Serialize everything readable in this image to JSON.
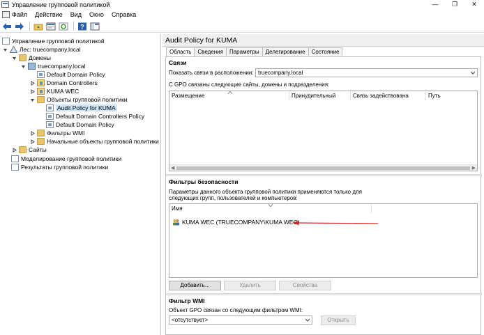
{
  "window": {
    "title": "Управление групповой политикой",
    "controls": [
      "—",
      "❐",
      "✕"
    ]
  },
  "menu": {
    "items": [
      "Файл",
      "Действие",
      "Вид",
      "Окно",
      "Справка"
    ]
  },
  "toolbar": {
    "icons": [
      "back-arrow-icon",
      "forward-arrow-icon",
      "folder-up-icon",
      "properties-icon",
      "refresh-icon",
      "help-icon",
      "console-icon"
    ]
  },
  "tree": {
    "root": "Управление групповой политикой",
    "forest": "Лес: truecompany.local",
    "domains": "Домены",
    "domain": "truecompany.local",
    "default_domain_policy": "Default Domain Policy",
    "domain_controllers": "Domain Controllers",
    "kuma_wec": "KUMA WEC",
    "gpo_objects": "Объекты групповой политики",
    "audit_policy": "Audit Policy for KUMA",
    "default_dc_policy": "Default Domain Controllers Policy",
    "default_domain_policy2": "Default Domain Policy",
    "wmi_filters": "Фильтры WMI",
    "starter_gpos": "Начальные объекты групповой политики",
    "sites": "Сайты",
    "modeling": "Моделирование групповой политики",
    "results": "Результаты групповой политики"
  },
  "right": {
    "header": "Audit Policy for KUMA",
    "tabs": [
      "Область",
      "Сведения",
      "Параметры",
      "Делегирование",
      "Состояние"
    ],
    "links": {
      "title": "Связи",
      "show_label": "Показать связи в расположении:",
      "location": "truecompany.local",
      "desc": "С GPO связаны следующие сайты, домены и подразделения:",
      "columns": [
        "Размещение",
        "Принудительный",
        "Связь задействована",
        "Путь"
      ]
    },
    "security": {
      "title": "Фильтры безопасности",
      "desc1": "Параметры данного объекта групповой политики применяются только для",
      "desc2": "следующих групп, пользователей и компьютеров:",
      "column": "Имя",
      "item": "KUMA WEC (TRUECOMPANY\\KUMA WEC)",
      "add": "Добавить...",
      "remove": "Удалить",
      "properties": "Свойства"
    },
    "wmi": {
      "title": "Фильтр WMI",
      "desc": "Объект GPO связан со следующим фильтром WMI:",
      "value": "<отсутствует>",
      "open": "Открыть"
    }
  },
  "colors": {
    "selection": "#cce4f7",
    "annotation_arrow": "#d62828"
  }
}
